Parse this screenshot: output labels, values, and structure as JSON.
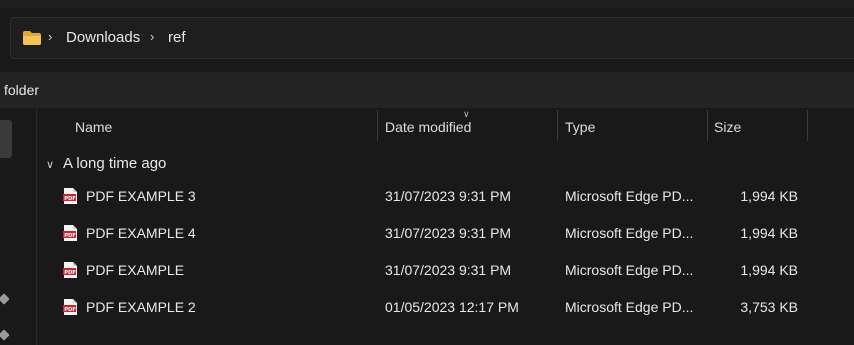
{
  "breadcrumb": {
    "items": [
      "Downloads",
      "ref"
    ]
  },
  "search": {
    "text": "folder"
  },
  "columns": {
    "name": "Name",
    "date": "Date modified",
    "type": "Type",
    "size": "Size"
  },
  "group": {
    "label": "A long time ago"
  },
  "files": [
    {
      "name": "PDF EXAMPLE 3",
      "date": "31/07/2023 9:31 PM",
      "type": "Microsoft Edge PD...",
      "size": "1,994 KB"
    },
    {
      "name": "PDF EXAMPLE 4",
      "date": "31/07/2023 9:31 PM",
      "type": "Microsoft Edge PD...",
      "size": "1,994 KB"
    },
    {
      "name": "PDF EXAMPLE",
      "date": "31/07/2023 9:31 PM",
      "type": "Microsoft Edge PD...",
      "size": "1,994 KB"
    },
    {
      "name": "PDF EXAMPLE 2",
      "date": "01/05/2023 12:17 PM",
      "type": "Microsoft Edge PD...",
      "size": "3,753 KB"
    }
  ],
  "icons": {
    "folder": "folder-icon",
    "file": "pdf-file-icon"
  },
  "colors": {
    "background": "#191919",
    "folder": "#f2c55c",
    "pdf_red": "#c8262c"
  }
}
